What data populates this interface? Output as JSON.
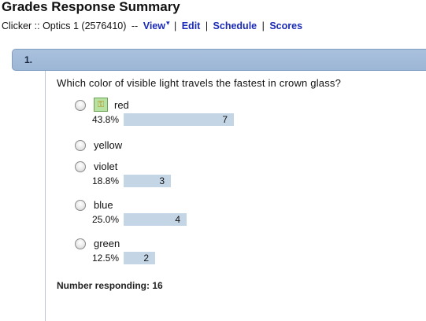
{
  "page": {
    "title": "Grades Response Summary"
  },
  "nav": {
    "crumb": "Clicker :: Optics 1 (2576410)",
    "separator": "--",
    "links": [
      "View",
      "Edit",
      "Schedule",
      "Scores"
    ]
  },
  "question": {
    "number": "1.",
    "collapse_symbol": "-",
    "text": "Which color of visible light travels the fastest in crown glass?",
    "answers": [
      {
        "label": "red",
        "correct": true,
        "percent": "43.8%",
        "count": "7",
        "fraction": 0.438
      },
      {
        "label": "yellow",
        "correct": false,
        "percent": "",
        "count": "",
        "fraction": 0
      },
      {
        "label": "violet",
        "correct": false,
        "percent": "18.8%",
        "count": "3",
        "fraction": 0.188
      },
      {
        "label": "blue",
        "correct": false,
        "percent": "25.0%",
        "count": "4",
        "fraction": 0.25
      },
      {
        "label": "green",
        "correct": false,
        "percent": "12.5%",
        "count": "2",
        "fraction": 0.125
      }
    ],
    "responding": "Number responding: 16"
  },
  "colors": {
    "link": "#1a2bb8",
    "header": "#a9c1dd",
    "bar": "#c4d5e6",
    "correct_badge": "#b7e2a2"
  },
  "icons": {
    "correct": "key-icon",
    "option": "radio-icon"
  }
}
